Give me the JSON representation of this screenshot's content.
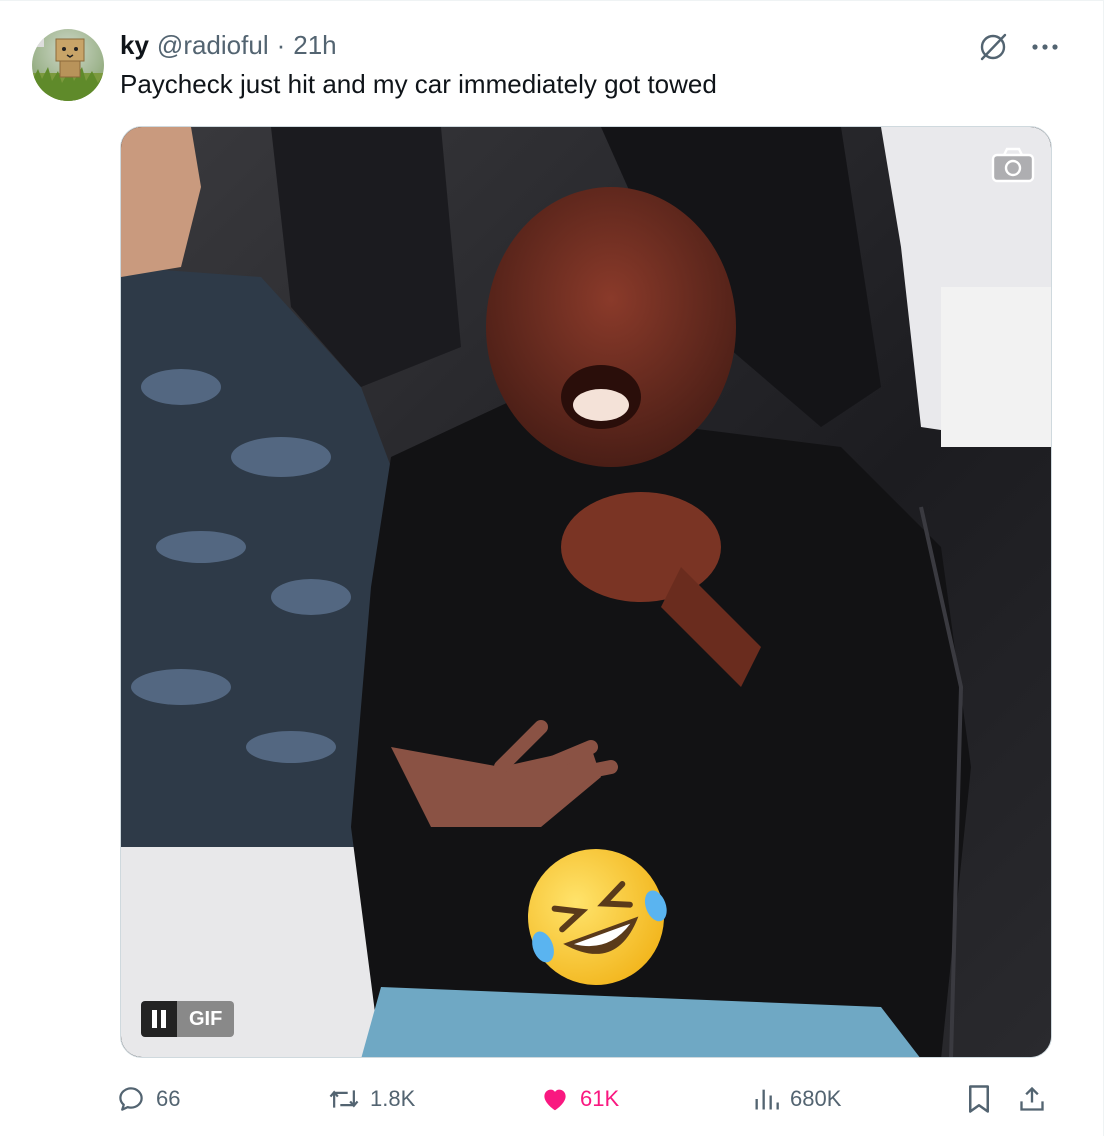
{
  "author": {
    "name": "ky",
    "handle": "@radioful",
    "separator": "·",
    "time": "21h"
  },
  "tweet": {
    "text": "Paycheck just hit and my car immediately got towed"
  },
  "media": {
    "type": "GIF",
    "badge": "GIF",
    "controls": {
      "pause_icon": "pause-icon",
      "camera_icon": "camera-icon"
    }
  },
  "actions": {
    "replies": "66",
    "reposts": "1.8K",
    "likes": "61K",
    "views": "680K"
  },
  "colors": {
    "text": "#0f1419",
    "muted": "#536471",
    "like": "#f91880",
    "border": "#cfd9de"
  }
}
